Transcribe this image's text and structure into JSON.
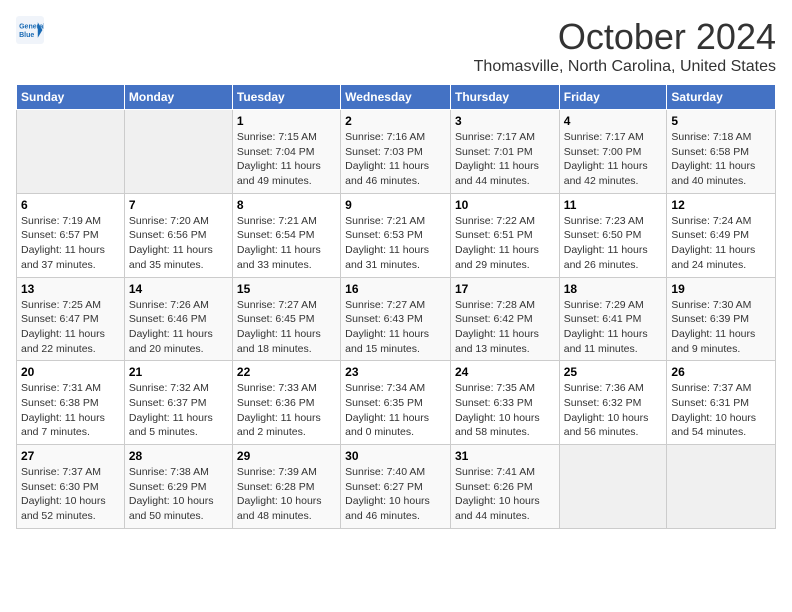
{
  "header": {
    "logo_line1": "General",
    "logo_line2": "Blue",
    "month": "October 2024",
    "location": "Thomasville, North Carolina, United States"
  },
  "weekdays": [
    "Sunday",
    "Monday",
    "Tuesday",
    "Wednesday",
    "Thursday",
    "Friday",
    "Saturday"
  ],
  "weeks": [
    [
      {
        "day": "",
        "sunrise": "",
        "sunset": "",
        "daylight": ""
      },
      {
        "day": "",
        "sunrise": "",
        "sunset": "",
        "daylight": ""
      },
      {
        "day": "1",
        "sunrise": "Sunrise: 7:15 AM",
        "sunset": "Sunset: 7:04 PM",
        "daylight": "Daylight: 11 hours and 49 minutes."
      },
      {
        "day": "2",
        "sunrise": "Sunrise: 7:16 AM",
        "sunset": "Sunset: 7:03 PM",
        "daylight": "Daylight: 11 hours and 46 minutes."
      },
      {
        "day": "3",
        "sunrise": "Sunrise: 7:17 AM",
        "sunset": "Sunset: 7:01 PM",
        "daylight": "Daylight: 11 hours and 44 minutes."
      },
      {
        "day": "4",
        "sunrise": "Sunrise: 7:17 AM",
        "sunset": "Sunset: 7:00 PM",
        "daylight": "Daylight: 11 hours and 42 minutes."
      },
      {
        "day": "5",
        "sunrise": "Sunrise: 7:18 AM",
        "sunset": "Sunset: 6:58 PM",
        "daylight": "Daylight: 11 hours and 40 minutes."
      }
    ],
    [
      {
        "day": "6",
        "sunrise": "Sunrise: 7:19 AM",
        "sunset": "Sunset: 6:57 PM",
        "daylight": "Daylight: 11 hours and 37 minutes."
      },
      {
        "day": "7",
        "sunrise": "Sunrise: 7:20 AM",
        "sunset": "Sunset: 6:56 PM",
        "daylight": "Daylight: 11 hours and 35 minutes."
      },
      {
        "day": "8",
        "sunrise": "Sunrise: 7:21 AM",
        "sunset": "Sunset: 6:54 PM",
        "daylight": "Daylight: 11 hours and 33 minutes."
      },
      {
        "day": "9",
        "sunrise": "Sunrise: 7:21 AM",
        "sunset": "Sunset: 6:53 PM",
        "daylight": "Daylight: 11 hours and 31 minutes."
      },
      {
        "day": "10",
        "sunrise": "Sunrise: 7:22 AM",
        "sunset": "Sunset: 6:51 PM",
        "daylight": "Daylight: 11 hours and 29 minutes."
      },
      {
        "day": "11",
        "sunrise": "Sunrise: 7:23 AM",
        "sunset": "Sunset: 6:50 PM",
        "daylight": "Daylight: 11 hours and 26 minutes."
      },
      {
        "day": "12",
        "sunrise": "Sunrise: 7:24 AM",
        "sunset": "Sunset: 6:49 PM",
        "daylight": "Daylight: 11 hours and 24 minutes."
      }
    ],
    [
      {
        "day": "13",
        "sunrise": "Sunrise: 7:25 AM",
        "sunset": "Sunset: 6:47 PM",
        "daylight": "Daylight: 11 hours and 22 minutes."
      },
      {
        "day": "14",
        "sunrise": "Sunrise: 7:26 AM",
        "sunset": "Sunset: 6:46 PM",
        "daylight": "Daylight: 11 hours and 20 minutes."
      },
      {
        "day": "15",
        "sunrise": "Sunrise: 7:27 AM",
        "sunset": "Sunset: 6:45 PM",
        "daylight": "Daylight: 11 hours and 18 minutes."
      },
      {
        "day": "16",
        "sunrise": "Sunrise: 7:27 AM",
        "sunset": "Sunset: 6:43 PM",
        "daylight": "Daylight: 11 hours and 15 minutes."
      },
      {
        "day": "17",
        "sunrise": "Sunrise: 7:28 AM",
        "sunset": "Sunset: 6:42 PM",
        "daylight": "Daylight: 11 hours and 13 minutes."
      },
      {
        "day": "18",
        "sunrise": "Sunrise: 7:29 AM",
        "sunset": "Sunset: 6:41 PM",
        "daylight": "Daylight: 11 hours and 11 minutes."
      },
      {
        "day": "19",
        "sunrise": "Sunrise: 7:30 AM",
        "sunset": "Sunset: 6:39 PM",
        "daylight": "Daylight: 11 hours and 9 minutes."
      }
    ],
    [
      {
        "day": "20",
        "sunrise": "Sunrise: 7:31 AM",
        "sunset": "Sunset: 6:38 PM",
        "daylight": "Daylight: 11 hours and 7 minutes."
      },
      {
        "day": "21",
        "sunrise": "Sunrise: 7:32 AM",
        "sunset": "Sunset: 6:37 PM",
        "daylight": "Daylight: 11 hours and 5 minutes."
      },
      {
        "day": "22",
        "sunrise": "Sunrise: 7:33 AM",
        "sunset": "Sunset: 6:36 PM",
        "daylight": "Daylight: 11 hours and 2 minutes."
      },
      {
        "day": "23",
        "sunrise": "Sunrise: 7:34 AM",
        "sunset": "Sunset: 6:35 PM",
        "daylight": "Daylight: 11 hours and 0 minutes."
      },
      {
        "day": "24",
        "sunrise": "Sunrise: 7:35 AM",
        "sunset": "Sunset: 6:33 PM",
        "daylight": "Daylight: 10 hours and 58 minutes."
      },
      {
        "day": "25",
        "sunrise": "Sunrise: 7:36 AM",
        "sunset": "Sunset: 6:32 PM",
        "daylight": "Daylight: 10 hours and 56 minutes."
      },
      {
        "day": "26",
        "sunrise": "Sunrise: 7:37 AM",
        "sunset": "Sunset: 6:31 PM",
        "daylight": "Daylight: 10 hours and 54 minutes."
      }
    ],
    [
      {
        "day": "27",
        "sunrise": "Sunrise: 7:37 AM",
        "sunset": "Sunset: 6:30 PM",
        "daylight": "Daylight: 10 hours and 52 minutes."
      },
      {
        "day": "28",
        "sunrise": "Sunrise: 7:38 AM",
        "sunset": "Sunset: 6:29 PM",
        "daylight": "Daylight: 10 hours and 50 minutes."
      },
      {
        "day": "29",
        "sunrise": "Sunrise: 7:39 AM",
        "sunset": "Sunset: 6:28 PM",
        "daylight": "Daylight: 10 hours and 48 minutes."
      },
      {
        "day": "30",
        "sunrise": "Sunrise: 7:40 AM",
        "sunset": "Sunset: 6:27 PM",
        "daylight": "Daylight: 10 hours and 46 minutes."
      },
      {
        "day": "31",
        "sunrise": "Sunrise: 7:41 AM",
        "sunset": "Sunset: 6:26 PM",
        "daylight": "Daylight: 10 hours and 44 minutes."
      },
      {
        "day": "",
        "sunrise": "",
        "sunset": "",
        "daylight": ""
      },
      {
        "day": "",
        "sunrise": "",
        "sunset": "",
        "daylight": ""
      }
    ]
  ]
}
